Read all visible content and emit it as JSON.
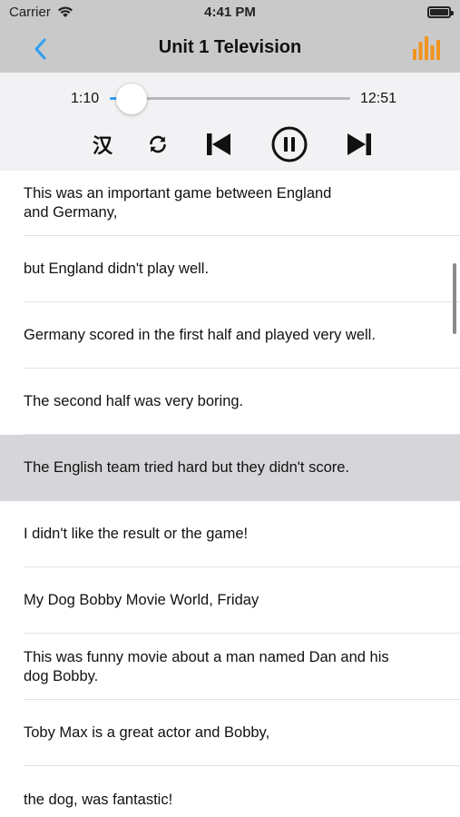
{
  "status_bar": {
    "carrier": "Carrier",
    "time": "4:41 PM"
  },
  "nav": {
    "title": "Unit 1 Television",
    "back_icon": "chevron-left-icon",
    "right_icon": "equalizer-icon",
    "accent_color": "#2d9ef2",
    "right_icon_color": "#f0941e"
  },
  "player": {
    "current_time": "1:10",
    "total_time": "12:51",
    "progress_fraction": 0.091,
    "translate_label": "汉",
    "controls": [
      "translate-toggle",
      "repeat-icon",
      "skip-previous-icon",
      "pause-icon",
      "skip-next-icon"
    ]
  },
  "lines": [
    {
      "text": "This was an important game between England\nand Germany,"
    },
    {
      "text": "but England didn't play well."
    },
    {
      "text": "Germany scored in the first half and played very well."
    },
    {
      "text": "The second half was very boring."
    },
    {
      "text": "The English team tried hard but they didn't score.",
      "active": true
    },
    {
      "text": "I didn't like the result or the game!"
    },
    {
      "text": "My Dog Bobby Movie World, Friday"
    },
    {
      "text": "This was funny movie about a man named Dan and his\ndog Bobby."
    },
    {
      "text": "Toby Max is a great actor and Bobby,"
    },
    {
      "text": "the dog, was fantastic!"
    }
  ]
}
